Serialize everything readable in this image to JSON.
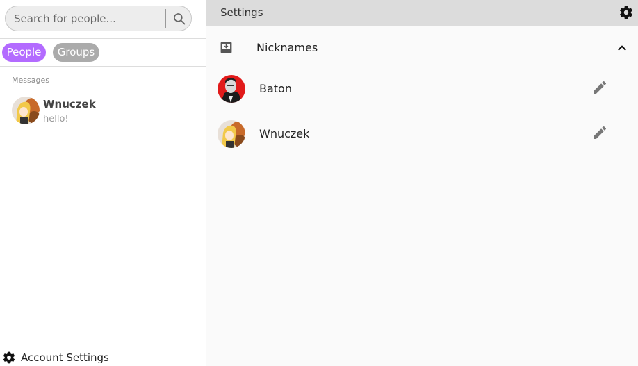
{
  "sidebar": {
    "search": {
      "placeholder": "Search for people...",
      "value": ""
    },
    "tabs": [
      {
        "label": "People",
        "active": true
      },
      {
        "label": "Groups",
        "active": false
      }
    ],
    "section_label": "Messages",
    "conversations": [
      {
        "name": "Wnuczek",
        "preview": "hello!"
      }
    ],
    "account_settings_label": "Account Settings"
  },
  "panel": {
    "title": "Settings",
    "nicknames": {
      "title": "Nicknames",
      "expanded": true,
      "people": [
        {
          "name": "Baton"
        },
        {
          "name": "Wnuczek"
        }
      ]
    }
  },
  "colors": {
    "accent": "#b36bff",
    "tab_inactive": "#ababab",
    "header_bg": "#dcdcdc",
    "panel_bg": "#fafafa"
  },
  "icons": {
    "search": "search-icon",
    "settings": "gear-icon",
    "nicknames": "inbox-download-icon",
    "collapse": "chevron-up-icon",
    "edit": "pencil-icon"
  }
}
